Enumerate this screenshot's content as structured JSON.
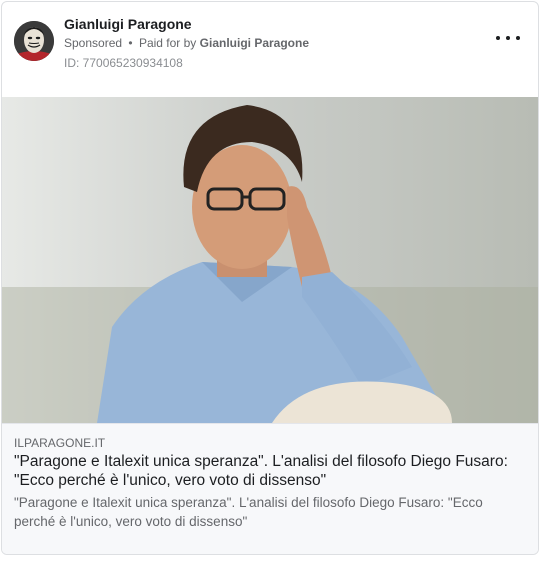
{
  "ad": {
    "advertiser_name": "Gianluigi Paragone",
    "sponsored_label": "Sponsored",
    "separator": "•",
    "paid_for_prefix": "Paid for by",
    "paid_for_by": "Gianluigi Paragone",
    "ad_id": "ID: 770065230934108"
  },
  "link": {
    "domain": "ILPARAGONE.IT",
    "headline": "\"Paragone e Italexit unica speranza\". L'analisi del filosofo Diego Fusaro: \"Ecco perché è l'unico, vero voto di dissenso\"",
    "description": "\"Paragone e Italexit unica speranza\". L'analisi del filosofo Diego Fusaro: \"Ecco perché è l'unico, vero voto di dissenso\""
  },
  "icons": {
    "avatar": "advertiser-avatar",
    "menu": "more-options-icon"
  },
  "colors": {
    "primary_text": "#1c1e21",
    "secondary_text": "#65676b",
    "footer_bg": "#f7f8fa",
    "border": "#dddfe2"
  }
}
